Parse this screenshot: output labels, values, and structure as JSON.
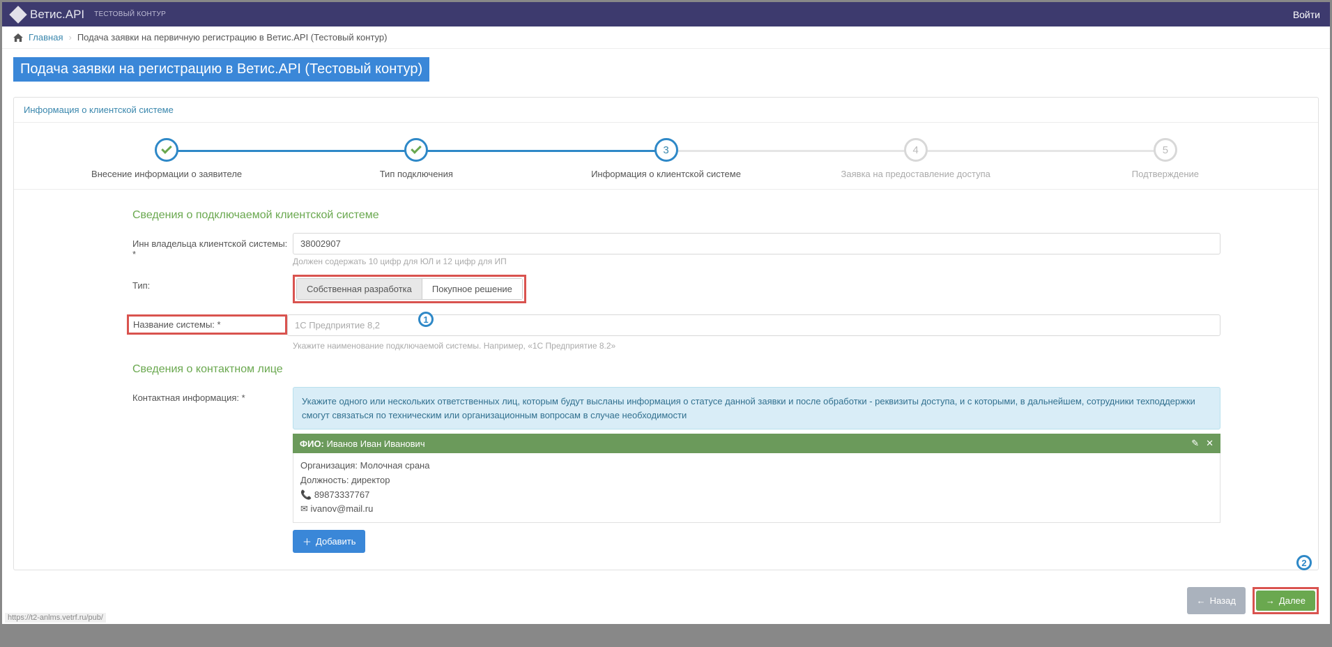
{
  "brand": {
    "title": "Ветис.API",
    "sub": "ТЕСТОВЫЙ КОНТУР"
  },
  "login": "Войти",
  "breadcrumb": {
    "home": "Главная",
    "current": "Подача заявки на первичную регистрацию в Ветис.API (Тестовый контур)"
  },
  "page_title": "Подача заявки на регистрацию в Ветис.API (Тестовый контур)",
  "panel_head": "Информация о клиентской системе",
  "steps": [
    {
      "label": "Внесение информации о заявителе",
      "state": "done"
    },
    {
      "label": "Тип подключения",
      "state": "done"
    },
    {
      "label": "Информация о клиентской системе",
      "state": "active",
      "num": "3"
    },
    {
      "label": "Заявка на предоставление доступа",
      "state": "pending",
      "num": "4"
    },
    {
      "label": "Подтверждение",
      "state": "pending",
      "num": "5"
    }
  ],
  "section1": "Сведения о подключаемой клиентской системе",
  "inn": {
    "label": "Инн владельца клиентской системы: *",
    "value": "38002907",
    "hint": "Должен содержать 10 цифр для ЮЛ и 12 цифр для ИП"
  },
  "type": {
    "label": "Тип:",
    "opt1": "Собственная разработка",
    "opt2": "Покупное решение"
  },
  "sysname": {
    "label": "Название системы: *",
    "placeholder": "1С Предприятие 8,2",
    "hint": "Укажите наименование подключаемой системы. Например, «1С Предприятие 8.2»"
  },
  "section2": "Сведения о контактном лице",
  "contact_label": "Контактная информация: *",
  "contact_info": "Укажите одного или нескольких ответственных лиц, которым будут высланы информация о статусе данной заявки и после обработки - реквизиты доступа, и с которыми, в дальнейшем, сотрудники техподдержки смогут связаться по техническим или организационным вопросам в случае необходимости",
  "contact": {
    "fio_label": "ФИО:",
    "fio": "Иванов Иван Иванович",
    "org_label": "Организация:",
    "org": "Молочная срана",
    "pos_label": "Должность:",
    "pos": "директор",
    "phone": "89873337767",
    "email": "ivanov@mail.ru"
  },
  "add_btn": "Добавить",
  "back_btn": "Назад",
  "next_btn": "Далее",
  "status_url": "https://t2-anlms.vetrf.ru/pub/",
  "markers": {
    "m1": "1",
    "m2": "2"
  }
}
